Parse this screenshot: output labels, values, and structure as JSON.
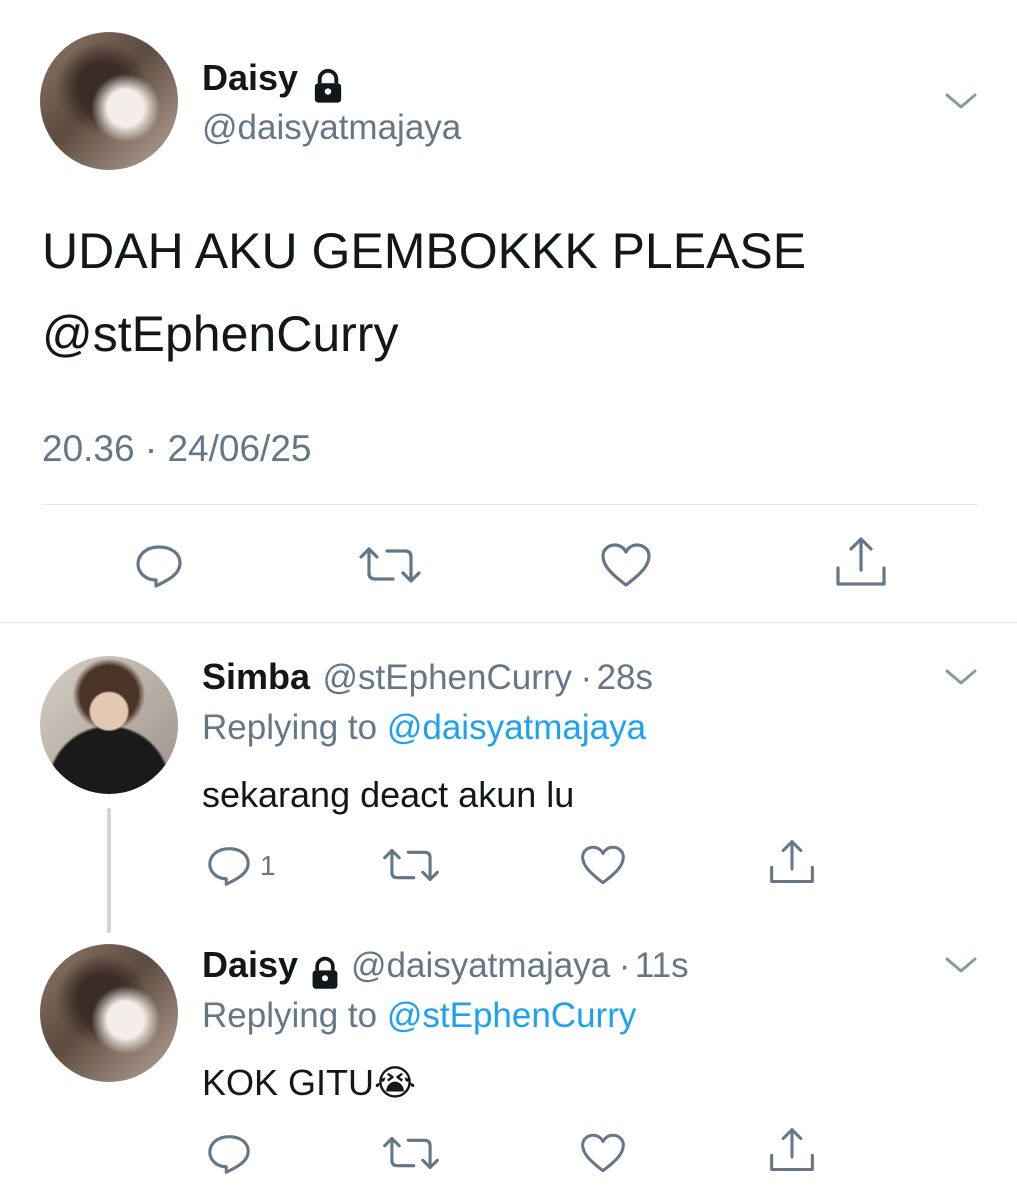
{
  "main_tweet": {
    "name": "Daisy",
    "handle": "@daisyatmajaya",
    "text": "UDAH AKU GEMBOKKK PLEASE",
    "mention": "@stEphenCurry",
    "timestamp": "20.36 · 24/06/25"
  },
  "replies": [
    {
      "name": "Simba",
      "handle": "@stEphenCurry",
      "sep": "·",
      "time": "28s",
      "replying_prefix": "Replying to",
      "replying_to": "@daisyatmajaya",
      "text": "sekarang deact akun lu",
      "reply_count": "1"
    },
    {
      "name": "Daisy",
      "handle": "@daisyatmajaya",
      "sep": "·",
      "time": "11s",
      "replying_prefix": "Replying to",
      "replying_to": "@stEphenCurry",
      "text": "KOK GITU",
      "emoji": "😭"
    }
  ],
  "icons": {
    "lock": "lock-icon",
    "caret": "chevron-down-icon",
    "reply": "reply-icon",
    "retweet": "retweet-icon",
    "like": "heart-icon",
    "share": "share-icon"
  },
  "colors": {
    "link": "#1da1f2",
    "muted": "#657786",
    "text": "#14171a",
    "icon": "#657786"
  }
}
